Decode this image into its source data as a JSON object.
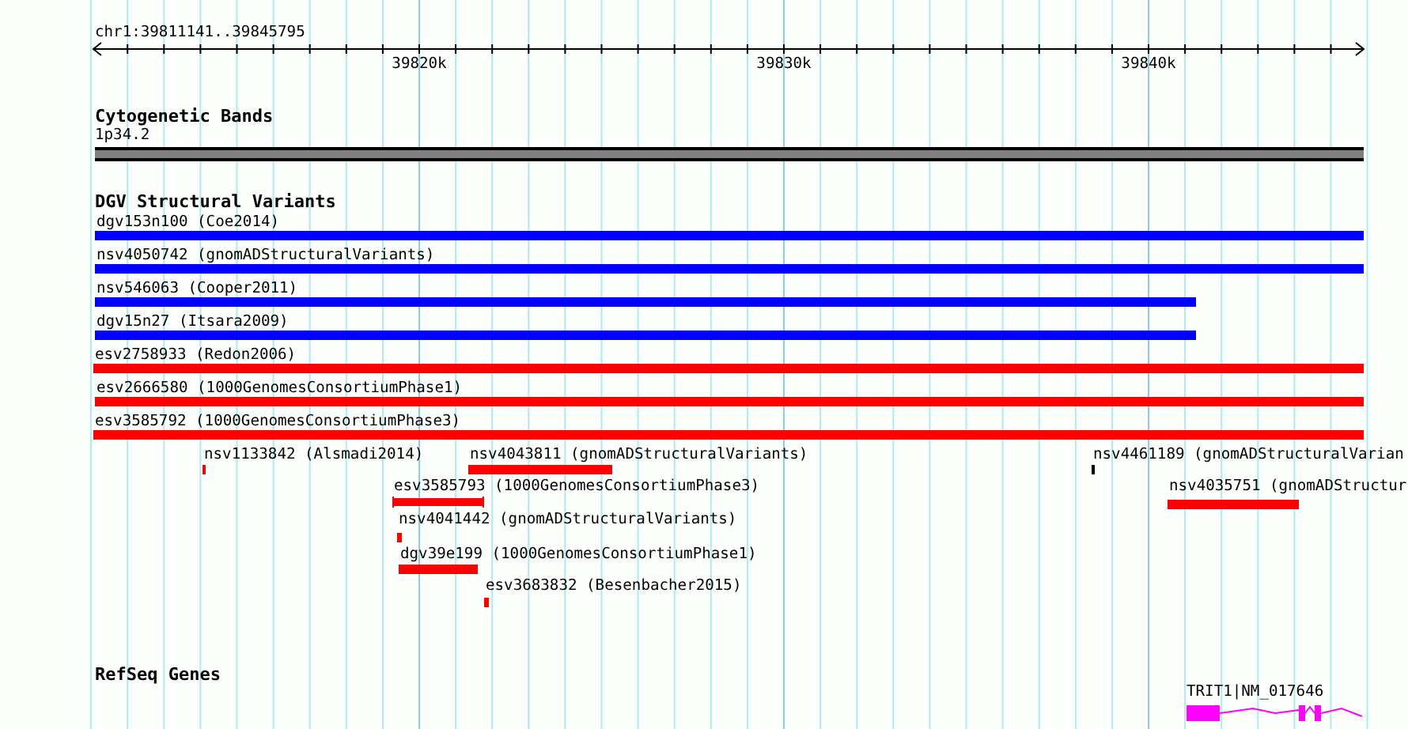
{
  "ruler": {
    "region": "chr1:39811141..39845795",
    "ticks": [
      "39820k",
      "39830k",
      "39840k"
    ]
  },
  "tracks": [
    {
      "kind": "cytoband",
      "title": "Cytogenetic Bands",
      "features": [
        {
          "label": "1p34.2"
        }
      ]
    },
    {
      "kind": "variants",
      "title": "DGV Structural Variants",
      "features": [
        {
          "label": "dgv153n100 (Coe2014)",
          "color": "#0000ff"
        },
        {
          "label": "nsv4050742 (gnomADStructuralVariants)",
          "color": "#0000ff"
        },
        {
          "label": "nsv546063 (Cooper2011)",
          "color": "#0000ff"
        },
        {
          "label": "dgv15n27 (Itsara2009)",
          "color": "#0000ff"
        },
        {
          "label": "esv2758933 (Redon2006)",
          "color": "#ff0000"
        },
        {
          "label": "esv2666580 (1000GenomesConsortiumPhase1)",
          "color": "#ff0000"
        },
        {
          "label": "esv3585792 (1000GenomesConsortiumPhase3)",
          "color": "#ff0000"
        },
        {
          "label": "nsv1133842 (Alsmadi2014)",
          "color": "#ff0000"
        },
        {
          "label": "nsv4043811 (gnomADStructuralVariants)",
          "color": "#ff0000"
        },
        {
          "label": "nsv4461189 (gnomADStructuralVarian",
          "color": "#000000"
        },
        {
          "label": "esv3585793 (1000GenomesConsortiumPhase3)",
          "color": "#ff0000"
        },
        {
          "label": "nsv4035751 (gnomADStructur",
          "color": "#ff0000"
        },
        {
          "label": "nsv4041442 (gnomADStructuralVariants)",
          "color": "#ff0000"
        },
        {
          "label": "dgv39e199 (1000GenomesConsortiumPhase1)",
          "color": "#ff0000"
        },
        {
          "label": "esv3683832 (Besenbacher2015)",
          "color": "#ff0000"
        }
      ]
    },
    {
      "kind": "genes",
      "title": "RefSeq Genes",
      "features": [
        {
          "label": "TRIT1|NM_017646"
        }
      ]
    }
  ]
}
